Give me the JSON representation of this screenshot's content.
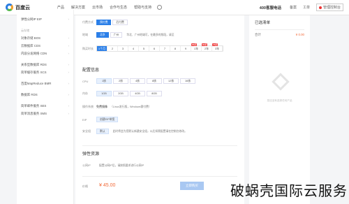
{
  "header": {
    "brand": "百度云",
    "nav": [
      "产品",
      "解决方案",
      "云市场",
      "合作与生态",
      "帮助与支持"
    ],
    "phone": "400客服电话",
    "links": [
      "备案",
      "工单"
    ],
    "console": "管理控制台"
  },
  "sidebar": {
    "groups": [
      {
        "title": "",
        "items": [
          {
            "label": "弹性公网IP EIP"
          }
        ]
      },
      {
        "title": "云存储",
        "items": [
          {
            "label": "对象存储 BOS"
          },
          {
            "label": "云数据库 CDS"
          },
          {
            "label": "内容分发网络 CDN"
          }
        ]
      },
      {
        "title": "",
        "items": [
          {
            "label": "关系型数据库 RDS"
          },
          {
            "label": "简单缓存服务 SCS"
          }
        ]
      },
      {
        "title": "",
        "items": [
          {
            "label": "百度MapReduce BMR"
          }
        ]
      },
      {
        "title": "",
        "items": [
          {
            "label": "数据库 RDS"
          }
        ]
      },
      {
        "title": "",
        "items": [
          {
            "label": "简单邮件服务 SES"
          },
          {
            "label": "简单消息服务 SMS"
          }
        ]
      }
    ]
  },
  "config": {
    "billing": {
      "label": "付费方式",
      "options": [
        "预付费",
        "后付费"
      ],
      "selected": 0
    },
    "region": {
      "label": "地域",
      "options": [
        "北京",
        "广州"
      ],
      "selected": 0,
      "desc": "华北、广州地域可，在最多的频段，请至"
    },
    "duration": {
      "label": "购买时长",
      "options": [
        "1个月",
        "2",
        "3",
        "4",
        "5",
        "6",
        "7",
        "8",
        "9",
        "1年",
        "2年",
        "3年"
      ],
      "selected": 0,
      "tags": [
        "85折",
        "80折",
        "75折"
      ]
    },
    "section_config": "配置信息",
    "cpu": {
      "label": "CPU",
      "options": [
        "1核",
        "2核",
        "4核",
        "8核",
        "12核",
        "16核"
      ],
      "selected": 0
    },
    "memory": {
      "label": "内存",
      "options": [
        "1GB",
        "2GB",
        "4GB",
        "8GB"
      ],
      "selected": 0
    },
    "os": {
      "label": "操作系统",
      "value": "免费镜像",
      "desc": "（Linux发行版，Windows需付费）"
    },
    "eip": {
      "label": "EIP",
      "value": "创建EIP带宽"
    },
    "security": {
      "label": "安全组",
      "value": "默认",
      "desc": "此时将会为您默认新建安全组，以后如需配置请在控制台修改。"
    },
    "section_extra": "弹性资源",
    "ip_label": "公网IP",
    "ip_desc": "配置公网IP后，请按照要求进行公网IP",
    "price_label": "价格",
    "price": "¥ 45.00",
    "buy_label": "立即购买"
  },
  "cart": {
    "title": "已选清单",
    "total_label": "合计",
    "total": "¥ 0.00",
    "empty_text": "您还没有选择任何产品"
  },
  "watermark": "破蜗壳国际云服务"
}
